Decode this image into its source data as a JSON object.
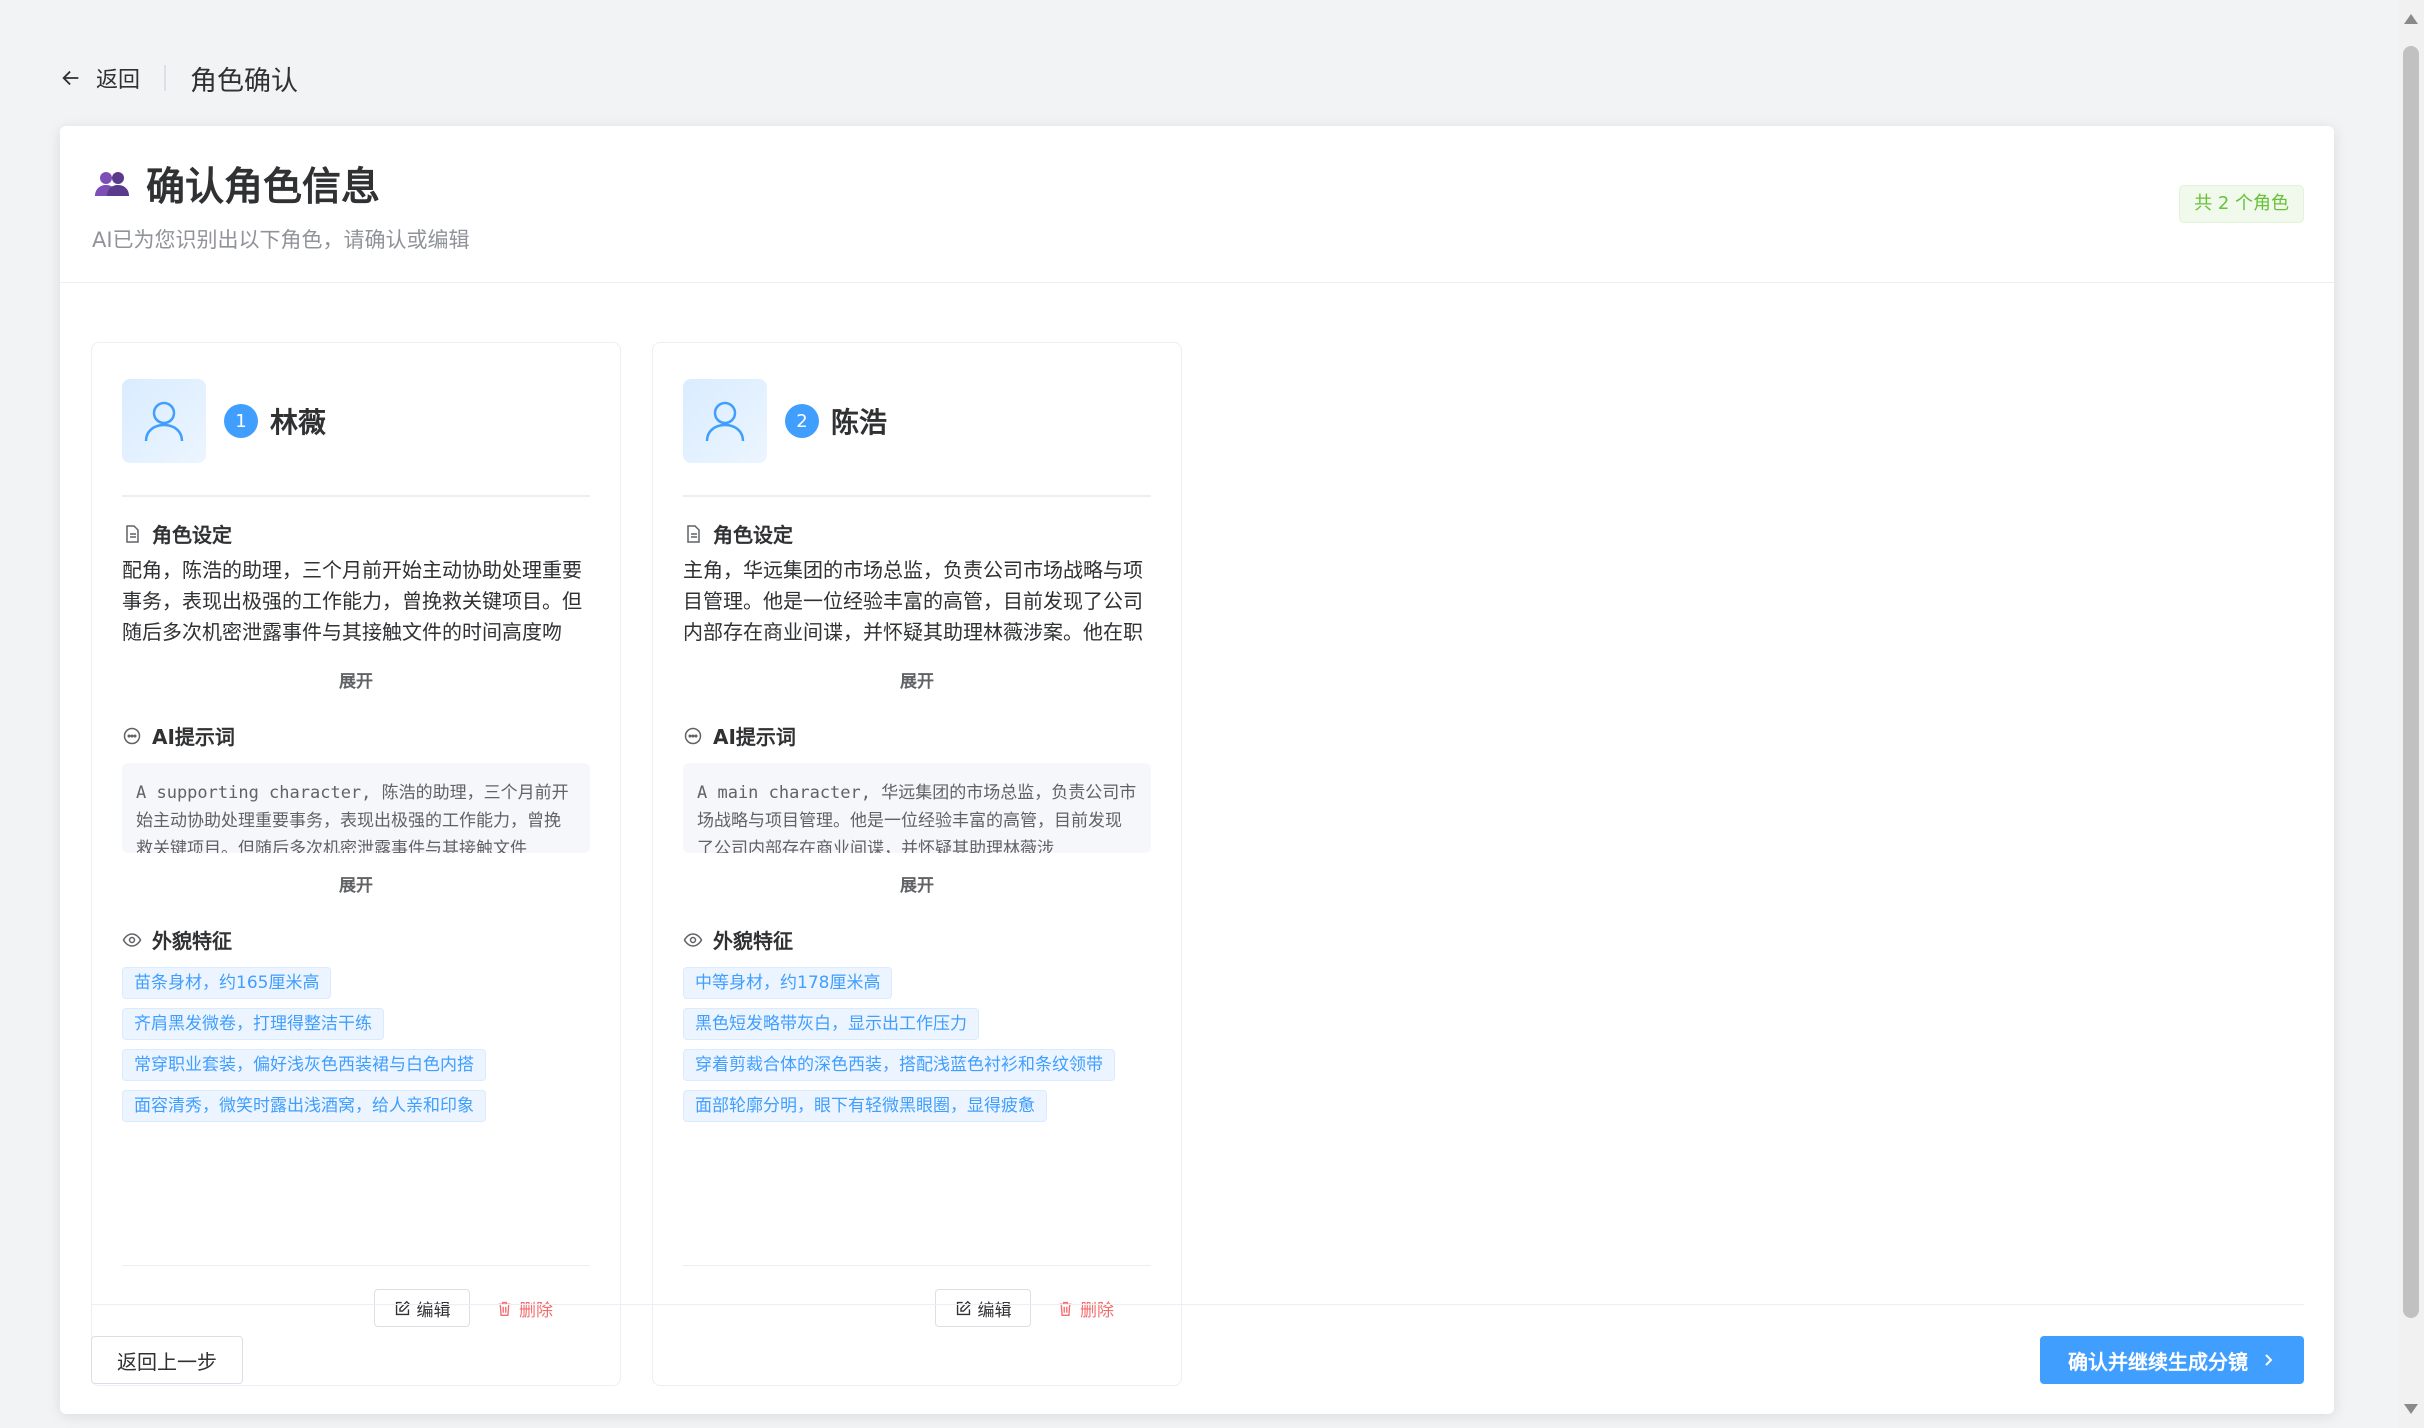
{
  "topbar": {
    "back_label": "返回",
    "page_title": "角色确认"
  },
  "header": {
    "title": "确认角色信息",
    "subtitle": "AI已为您识别出以下角色，请确认或编辑",
    "count_badge": "共 2 个角色"
  },
  "section_titles": {
    "setting": "角色设定",
    "prompt": "AI提示词",
    "appearance": "外貌特征"
  },
  "expand_label": "展开",
  "edit_label": "编辑",
  "delete_label": "删除",
  "characters": [
    {
      "index": "1",
      "name": "林薇",
      "description": "配角，陈浩的助理，三个月前开始主动协助处理重要事务，表现出极强的工作能力，曾挽救关键项目。但随后多次机密泄露事件与其接触文件的时间高度吻合，引发",
      "prompt": "A supporting character, 陈浩的助理，三个月前开始主动协助处理重要事务，表现出极强的工作能力，曾挽救关键项目。但随后多次机密泄露事件与其接触文件",
      "tags": [
        "苗条身材，约165厘米高",
        "齐肩黑发微卷，打理得整洁干练",
        "常穿职业套装，偏好浅灰色西装裙与白色内搭",
        "面容清秀，微笑时露出浅酒窝，给人亲和印象"
      ]
    },
    {
      "index": "2",
      "name": "陈浩",
      "description": "主角，华远集团的市场总监，负责公司市场战略与项目管理。他是一位经验丰富的高管，目前发现了公司内部存在商业间谍，并怀疑其助理林薇涉案。他在职责与信",
      "prompt": "A main character, 华远集团的市场总监，负责公司市场战略与项目管理。他是一位经验丰富的高管，目前发现了公司内部存在商业间谍，并怀疑其助理林薇涉",
      "tags": [
        "中等身材，约178厘米高",
        "黑色短发略带灰白，显示出工作压力",
        "穿着剪裁合体的深色西装，搭配浅蓝色衬衫和条纹领带",
        "面部轮廓分明，眼下有轻微黑眼圈，显得疲惫"
      ]
    }
  ],
  "footer": {
    "prev_label": "返回上一步",
    "confirm_label": "确认并继续生成分镜"
  },
  "colors": {
    "primary": "#409eff",
    "success": "#67c23a",
    "danger": "#f56c6c"
  },
  "icons": [
    "back-arrow-icon",
    "users-icon",
    "user-icon",
    "document-icon",
    "chat-icon",
    "eye-icon",
    "edit-icon",
    "trash-icon",
    "chevron-right-icon"
  ]
}
